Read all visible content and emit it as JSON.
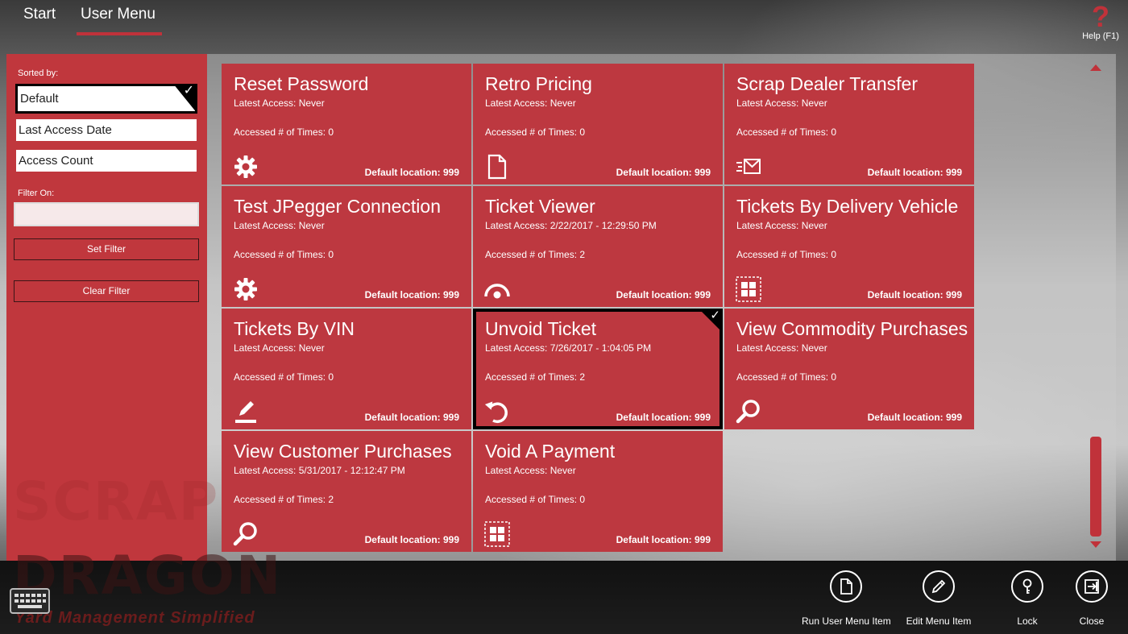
{
  "nav": {
    "tabs": [
      {
        "label": "Start"
      },
      {
        "label": "User Menu",
        "active": true
      }
    ],
    "help_label": "Help (F1)",
    "help_icon": "?"
  },
  "sidebar": {
    "sorted_by_label": "Sorted by:",
    "sort_options": [
      {
        "label": "Default",
        "selected": true
      },
      {
        "label": "Last Access Date",
        "selected": false
      },
      {
        "label": "Access Count",
        "selected": false
      }
    ],
    "filter_label": "Filter On:",
    "filter_value": "",
    "set_filter_label": "Set Filter",
    "clear_filter_label": "Clear Filter"
  },
  "tiles": [
    {
      "title": "Reset Password",
      "latest": "Latest Access: Never",
      "count": "Accessed # of Times: 0",
      "location": "Default location: 999",
      "icon": "gear-icon"
    },
    {
      "title": "Retro Pricing",
      "latest": "Latest Access: Never",
      "count": "Accessed # of Times: 0",
      "location": "Default location: 999",
      "icon": "document-icon"
    },
    {
      "title": "Scrap Dealer Transfer",
      "latest": "Latest Access: Never",
      "count": "Accessed # of Times: 0",
      "location": "Default location: 999",
      "icon": "mail-transfer-icon"
    },
    {
      "title": "Test JPegger Connection",
      "latest": "Latest Access: Never",
      "count": "Accessed # of Times: 0",
      "location": "Default location: 999",
      "icon": "gear-icon"
    },
    {
      "title": "Ticket Viewer",
      "latest": "Latest Access: 2/22/2017 - 12:29:50 PM",
      "count": "Accessed # of Times: 2",
      "location": "Default location: 999",
      "icon": "eye-icon"
    },
    {
      "title": "Tickets By Delivery Vehicle",
      "latest": "Latest Access: Never",
      "count": "Accessed # of Times: 0",
      "location": "Default location: 999",
      "icon": "grid-icon"
    },
    {
      "title": "Tickets By VIN",
      "latest": "Latest Access: Never",
      "count": "Accessed # of Times: 0",
      "location": "Default location: 999",
      "icon": "edit-icon"
    },
    {
      "title": "Unvoid Ticket",
      "latest": "Latest Access: 7/26/2017 - 1:04:05 PM",
      "count": "Accessed # of Times: 2",
      "location": "Default location: 999",
      "icon": "undo-icon",
      "selected": true,
      "check": "✓"
    },
    {
      "title": "View Commodity Purchases",
      "latest": "Latest Access: Never",
      "count": "Accessed # of Times: 0",
      "location": "Default location: 999",
      "icon": "search-icon"
    },
    {
      "title": "View Customer Purchases",
      "latest": "Latest Access: 5/31/2017 - 12:12:47 PM",
      "count": "Accessed # of Times: 2",
      "location": "Default location: 999",
      "icon": "search-icon"
    },
    {
      "title": "Void A Payment",
      "latest": "Latest Access: Never",
      "count": "Accessed # of Times: 0",
      "location": "Default location: 999",
      "icon": "grid-icon"
    }
  ],
  "logo": {
    "line1": "SCRAP",
    "line2": "DRAGON",
    "tagline": "Yard Management Simplified"
  },
  "actions": [
    {
      "label": "Run User Menu Item",
      "icon": "document-icon"
    },
    {
      "label": "Edit Menu Item",
      "icon": "pencil-icon"
    },
    {
      "label": "Lock",
      "icon": "key-icon"
    },
    {
      "label": "Close",
      "icon": "exit-icon"
    }
  ],
  "colors": {
    "accent": "#c0323a",
    "tile": "#bd3840",
    "sidebar": "#c0373d"
  }
}
